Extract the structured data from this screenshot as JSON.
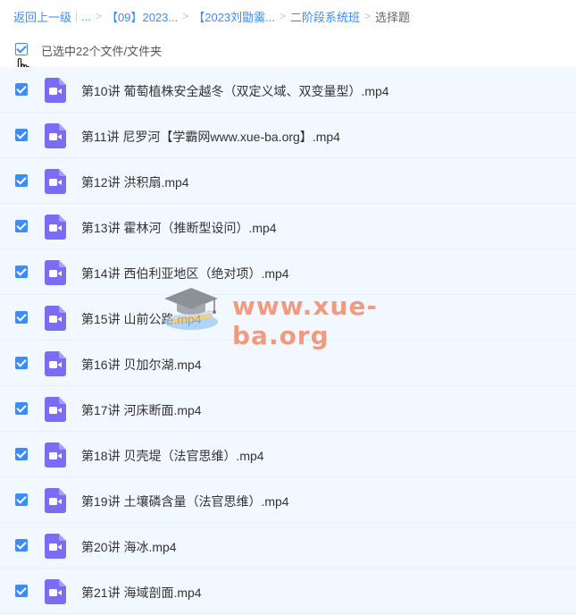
{
  "breadcrumb": {
    "back": "返回上一级",
    "bar": "|",
    "ellipsis": "...",
    "sep": ">",
    "items": [
      "【09】2023...",
      "【2023刘勖霙...",
      "二阶段系统班"
    ],
    "current": "选择题"
  },
  "selection": {
    "label": "已选中22个文件/文件夹"
  },
  "files": [
    {
      "name": "第10讲 葡萄植株安全越冬（双定义域、双变量型）.mp4"
    },
    {
      "name": "第11讲 尼罗河【学霸网www.xue-ba.org】.mp4"
    },
    {
      "name": "第12讲 洪积扇.mp4"
    },
    {
      "name": "第13讲 霍林河（推断型设问）.mp4"
    },
    {
      "name": "第14讲 西伯利亚地区（绝对项）.mp4"
    },
    {
      "name": "第15讲 山前公路.mp4"
    },
    {
      "name": "第16讲 贝加尔湖.mp4"
    },
    {
      "name": "第17讲 河床断面.mp4"
    },
    {
      "name": "第18讲 贝壳堤（法官思维）.mp4"
    },
    {
      "name": "第19讲 土壤磷含量（法官思维）.mp4"
    },
    {
      "name": "第20讲 海冰.mp4"
    },
    {
      "name": "第21讲 海域剖面.mp4"
    }
  ],
  "watermark": {
    "text": "www.xue-ba.org"
  },
  "colors": {
    "accent": "#3b8cff",
    "row_bg": "#f2f8ff",
    "video_icon": "#7b6cf6"
  }
}
